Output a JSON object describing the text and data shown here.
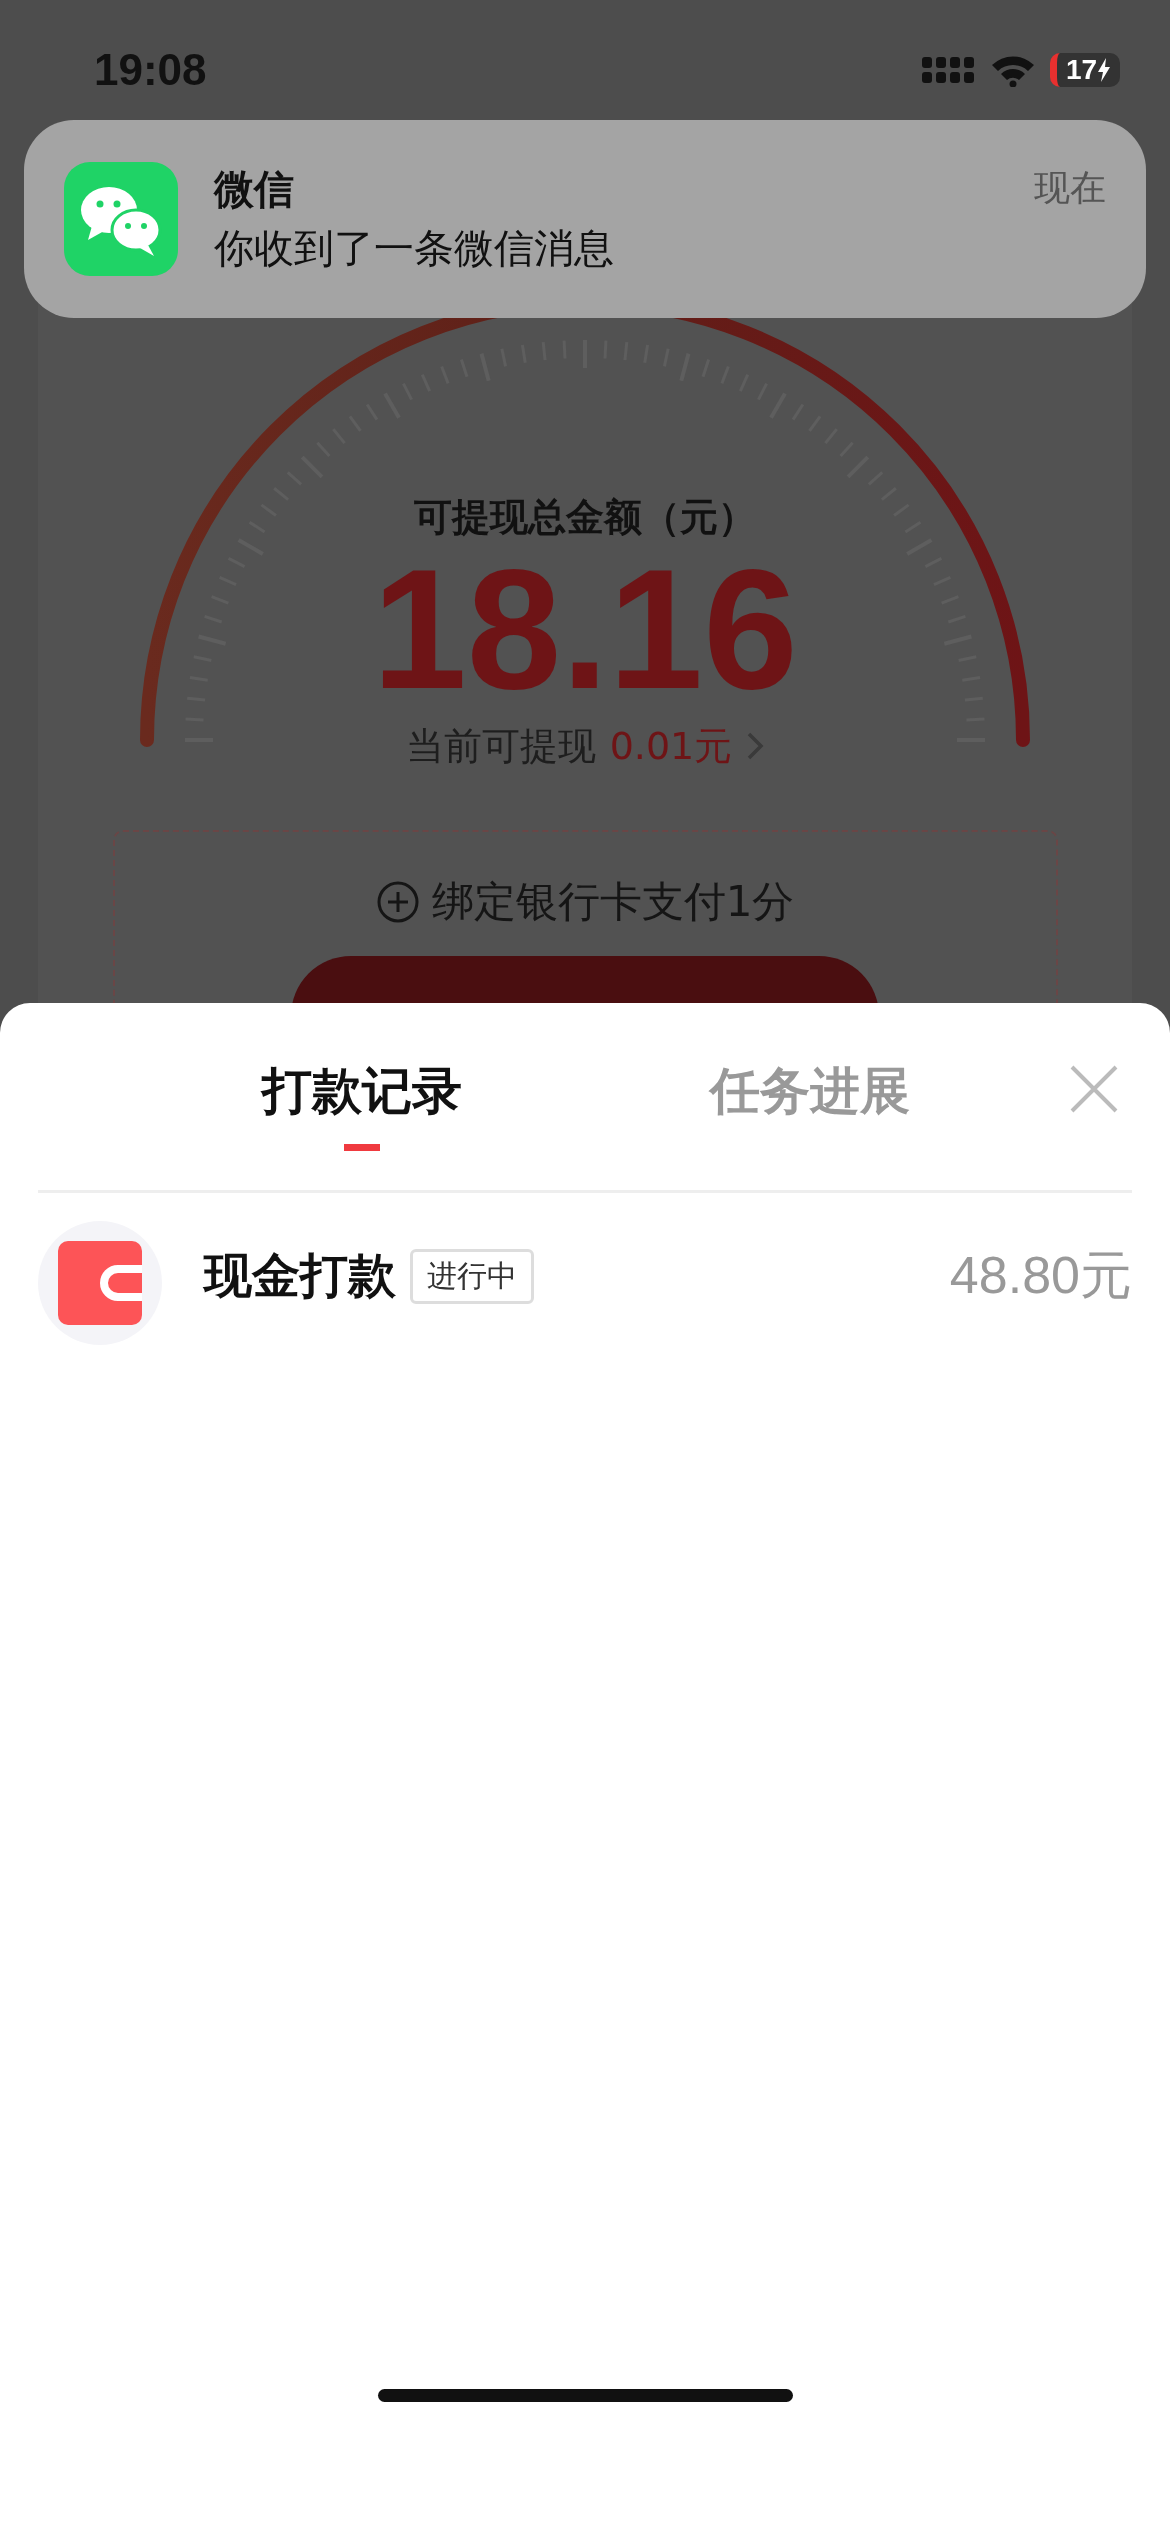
{
  "status_bar": {
    "time": "19:08",
    "battery": "17"
  },
  "notification": {
    "app": "微信",
    "message": "你收到了一条微信消息",
    "time": "现在"
  },
  "withdraw": {
    "title": "可提现总金额（元）",
    "amount": "18.16",
    "current_label": "当前可提现",
    "current_amount": "0.01元",
    "bind_label": "绑定银行卡支付1分"
  },
  "tabs": [
    {
      "label": "打款记录",
      "selected": true
    },
    {
      "label": "任务进展",
      "selected": false
    }
  ],
  "records": [
    {
      "title": "现金打款",
      "status": "进行中",
      "amount": "48.80元"
    }
  ]
}
